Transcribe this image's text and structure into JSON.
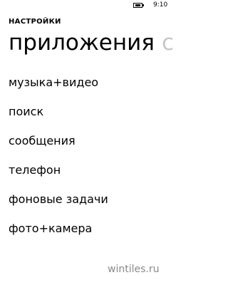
{
  "status_bar": {
    "battery_icon": "battery-charging-icon",
    "time": "9:10"
  },
  "header": {
    "app_title": "НАСТРОЙКИ"
  },
  "pivot": {
    "active_label": "приложения",
    "next_label_partial": "с"
  },
  "menu": {
    "items": [
      {
        "label": "музыка+видео"
      },
      {
        "label": "поиск"
      },
      {
        "label": "сообщения"
      },
      {
        "label": "телефон"
      },
      {
        "label": "фоновые задачи"
      },
      {
        "label": "фото+камера"
      }
    ]
  },
  "watermark": "wintiles.ru",
  "colors": {
    "background": "#ffffff",
    "text": "#000000",
    "inactive_pivot": "#c8c8c8",
    "watermark": "#8a8a8a"
  }
}
